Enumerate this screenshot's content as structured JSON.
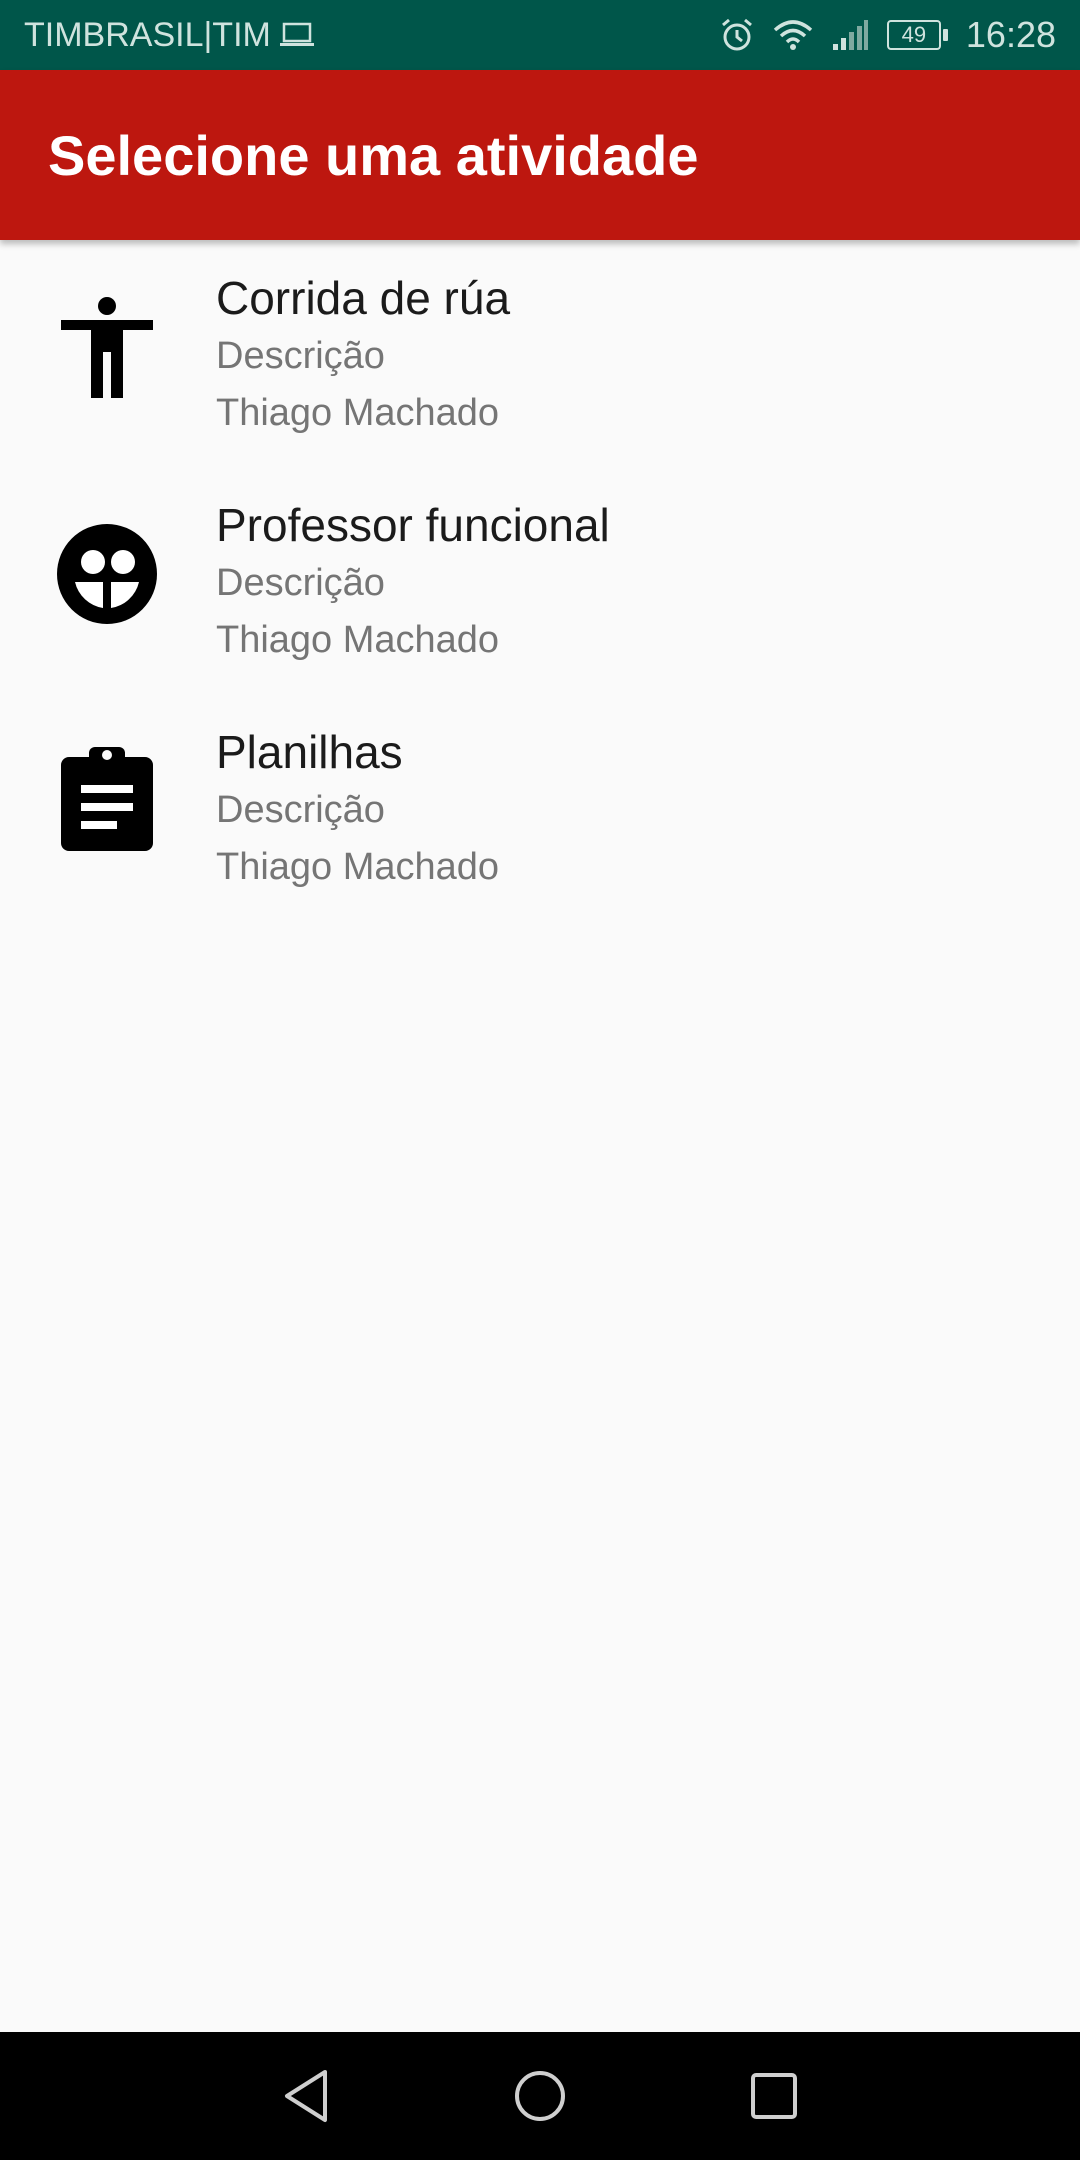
{
  "status_bar": {
    "carrier": "TIMBRASIL|TIM",
    "battery": "49",
    "time": "16:28"
  },
  "app_bar": {
    "title": "Selecione uma atividade",
    "color": "#bd170f"
  },
  "activities": [
    {
      "icon": "accessibility-icon",
      "title": "Corrida de rúa",
      "description": "Descrição",
      "author": "Thiago Machado"
    },
    {
      "icon": "group-face-icon",
      "title": "Professor funcional",
      "description": "Descrição",
      "author": "Thiago Machado"
    },
    {
      "icon": "clipboard-icon",
      "title": "Planilhas",
      "description": "Descrição",
      "author": "Thiago Machado"
    }
  ],
  "colors": {
    "status_bar": "#00564a",
    "background": "#fafafa",
    "primary_text": "#1b1b1b",
    "secondary_text": "#757575"
  }
}
